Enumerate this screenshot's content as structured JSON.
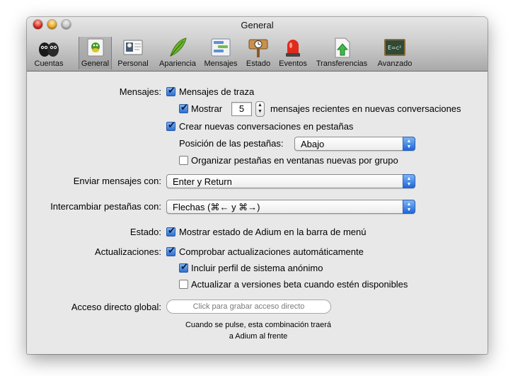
{
  "window": {
    "title": "General"
  },
  "toolbar": {
    "items": [
      {
        "label": "Cuentas",
        "icon": "accounts-icon"
      },
      {
        "label": "General",
        "icon": "general-icon",
        "selected": true
      },
      {
        "label": "Personal",
        "icon": "personal-icon"
      },
      {
        "label": "Apariencia",
        "icon": "appearance-icon"
      },
      {
        "label": "Mensajes",
        "icon": "messages-icon"
      },
      {
        "label": "Estado",
        "icon": "status-icon"
      },
      {
        "label": "Eventos",
        "icon": "events-icon"
      },
      {
        "label": "Transferencias",
        "icon": "transfers-icon"
      },
      {
        "label": "Avanzado",
        "icon": "advanced-icon"
      }
    ]
  },
  "messages": {
    "label": "Mensajes:",
    "trace_label": "Mensajes de traza",
    "trace_checked": true,
    "show_label": "Mostrar",
    "show_checked": true,
    "show_count": "5",
    "show_suffix": "mensajes recientes en nuevas conversaciones",
    "tabs_label": "Crear nuevas conversaciones en pestañas",
    "tabs_checked": true,
    "tab_position_label": "Posición de las pestañas:",
    "tab_position_value": "Abajo",
    "organize_label": "Organizar pestañas en ventanas nuevas por grupo",
    "organize_checked": false
  },
  "send": {
    "label": "Enviar mensajes con:",
    "value": "Enter y Return"
  },
  "switch_tabs": {
    "label": "Intercambiar pestañas con:",
    "value": "Flechas (⌘← y ⌘→)"
  },
  "status": {
    "label": "Estado:",
    "option_label": "Mostrar estado de Adium en la barra de menú",
    "checked": true
  },
  "updates": {
    "label": "Actualizaciones:",
    "auto_label": "Comprobar actualizaciones automáticamente",
    "auto_checked": true,
    "profile_label": "Incluir perfil de sistema anónimo",
    "profile_checked": true,
    "beta_label": "Actualizar a versiones beta cuando estén disponibles",
    "beta_checked": false
  },
  "hotkey": {
    "label": "Acceso directo global:",
    "placeholder": "Click para grabar acceso directo",
    "hint_line1": "Cuando se pulse, esta combinación traerá",
    "hint_line2": "a Adium al frente"
  },
  "colors": {
    "accent": "#2d6fd1",
    "toolbar_top": "#e6e6e6",
    "toolbar_bottom": "#a9a9a9",
    "window_bg": "#e8e8e8"
  }
}
